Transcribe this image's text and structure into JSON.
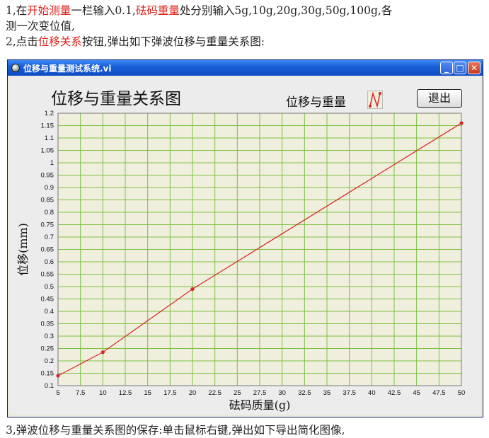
{
  "document": {
    "line1": [
      "1,在",
      "开始测量",
      "一栏输入0.1,",
      "砝码重量",
      "处分别输入5g,10g,20g,30g,50g,100g,各"
    ],
    "line2": "测一次变位值,",
    "line3": [
      "2,点击",
      "位移关系",
      "按钮,弹出如下弹波位移与重量关系图:"
    ],
    "line4": "3,弹波位移与重量关系图的保存:单击鼠标右键,弹出如下导出简化图像,"
  },
  "window": {
    "title": "位移与重量测试系统.vi",
    "buttons": {
      "minimize": "_",
      "maximize": "□",
      "close": "✕"
    },
    "chart_title": "位移与重量关系图",
    "legend_label": "位移与重量",
    "exit_button": "退出"
  },
  "colors": {
    "accent_red": "#e0211b",
    "grid": "#7bc142",
    "plot_bg": "#f0eedc",
    "line": "#d92525"
  },
  "chart_data": {
    "type": "line",
    "title": "位移与重量关系图",
    "xlabel": "砝码质量(g)",
    "ylabel": "位移(mm)",
    "xlim": [
      5,
      50
    ],
    "ylim": [
      0.1,
      1.2
    ],
    "xticks": [
      "5",
      "7.5",
      "10",
      "12.5",
      "15",
      "17.5",
      "20",
      "22.5",
      "25",
      "27.5",
      "30",
      "32.5",
      "35",
      "37.5",
      "40",
      "42.5",
      "45",
      "47.5",
      "50"
    ],
    "yticks": [
      "0.1",
      "0.15",
      "0.2",
      "0.25",
      "0.3",
      "0.35",
      "0.4",
      "0.45",
      "0.5",
      "0.55",
      "0.6",
      "0.65",
      "0.7",
      "0.75",
      "0.8",
      "0.85",
      "0.9",
      "0.95",
      "1",
      "1.05",
      "1.1",
      "1.15",
      "1.2"
    ],
    "grid": true,
    "legend": "top",
    "series": [
      {
        "name": "位移与重量",
        "x": [
          5,
          10,
          20,
          50
        ],
        "y": [
          0.14,
          0.235,
          0.49,
          1.16
        ]
      }
    ]
  }
}
